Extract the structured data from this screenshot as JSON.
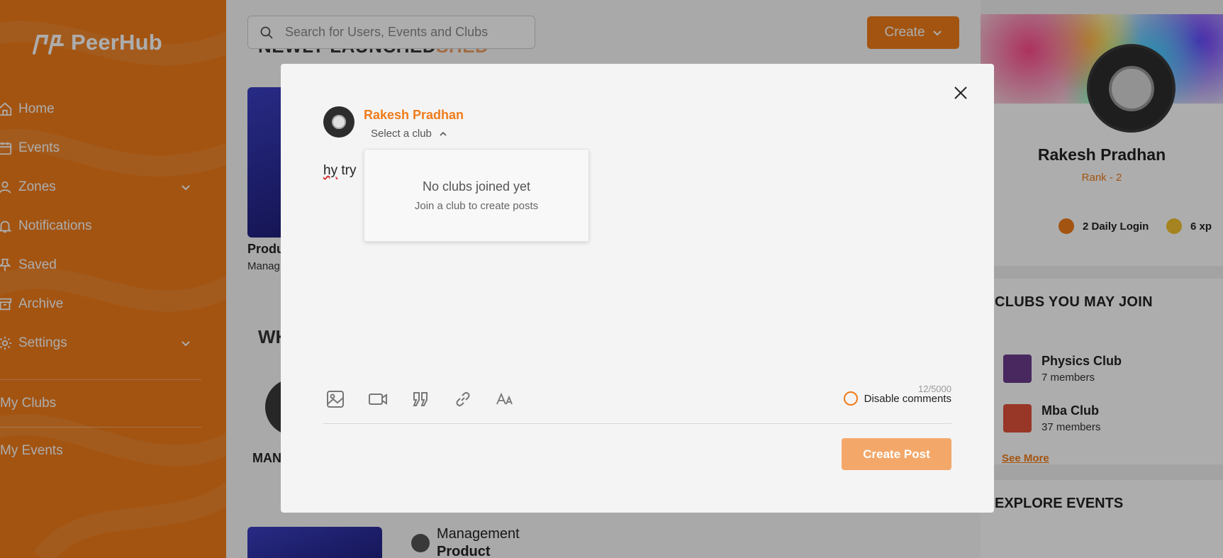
{
  "sidebar": {
    "brand": "PeerHub",
    "items": [
      {
        "label": "Home"
      },
      {
        "label": "Events"
      },
      {
        "label": "Zones"
      },
      {
        "label": "Notifications"
      },
      {
        "label": "Saved"
      },
      {
        "label": "Archive"
      },
      {
        "label": "Settings"
      }
    ],
    "my_clubs": "My Clubs",
    "my_events": "My Events"
  },
  "header": {
    "search_placeholder": "Search for Users, Events and Clubs",
    "create_label": "Create"
  },
  "background": {
    "heading_dark": "NEWLY LAUNCHED",
    "heading_light": "SHED",
    "card_title": "Produ",
    "card_sub": "Manag",
    "section2": "WH",
    "person": "MAN",
    "mgmt_label": "Management",
    "mgmt_sub": "Product"
  },
  "profile": {
    "name": "Rakesh Pradhan",
    "rank": "Rank - 2",
    "daily_login": "2 Daily Login",
    "xp": "6 xp"
  },
  "clubs": {
    "title": "CLUBS YOU MAY JOIN",
    "list": [
      {
        "name": "Physics Club",
        "members": "7 members",
        "color": "#6a3b8c"
      },
      {
        "name": "Mba Club",
        "members": "37 members",
        "color": "#e0503a"
      }
    ],
    "see_more": "See More"
  },
  "events": {
    "title": "EXPLORE EVENTS"
  },
  "modal": {
    "user_name": "Rakesh Pradhan",
    "select_club": "Select a club",
    "post_text": "hy try",
    "post_text_underlined": "hy",
    "post_text_rest": " try",
    "dropdown_title": "No clubs joined yet",
    "dropdown_sub": "Join a club to create posts",
    "char_count": "12/5000",
    "disable_comments": "Disable comments",
    "create_post": "Create Post"
  },
  "colors": {
    "accent": "#f07c1a",
    "button_disabled": "#f3a86a"
  }
}
